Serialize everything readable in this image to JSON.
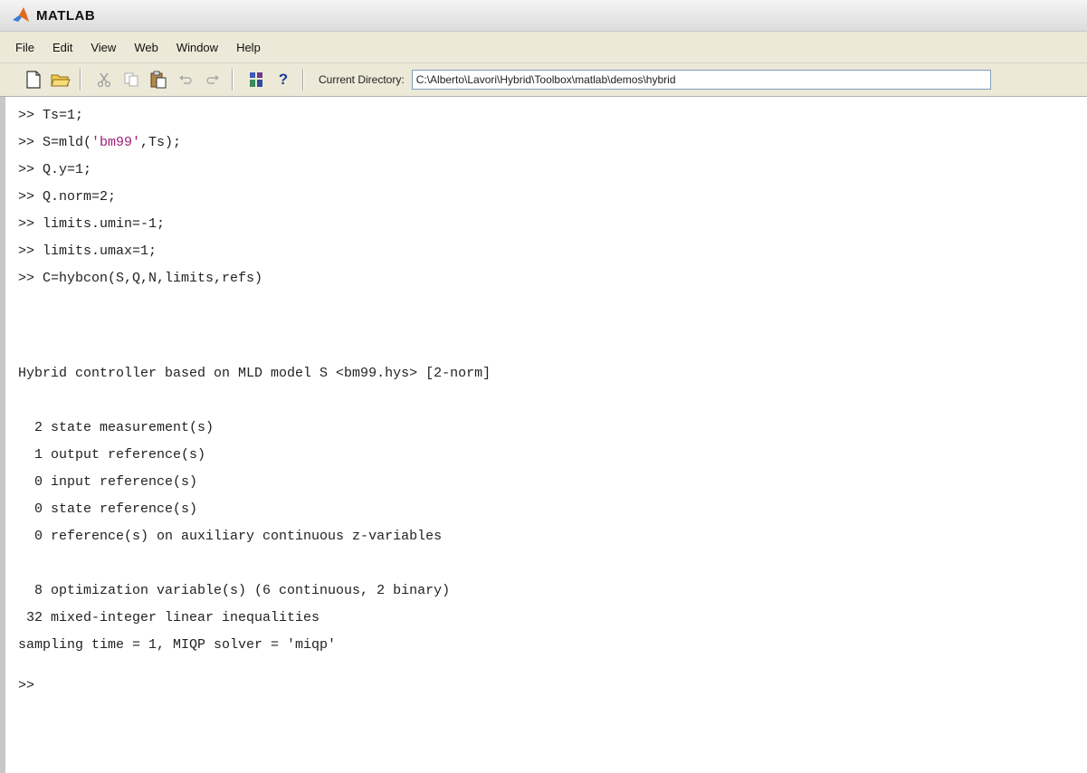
{
  "window": {
    "title": "MATLAB"
  },
  "menu": [
    "File",
    "Edit",
    "View",
    "Web",
    "Window",
    "Help"
  ],
  "toolbar": {
    "buttons": [
      "new-file-icon",
      "open-folder-icon",
      "cut-icon",
      "copy-icon",
      "paste-icon",
      "undo-icon",
      "redo-icon",
      "simulink-icon",
      "help-icon"
    ],
    "help_label": "?",
    "current_directory_label": "Current Directory:",
    "current_directory_value": "C:\\Alberto\\Lavori\\Hybrid\\Toolbox\\matlab\\demos\\hybrid"
  },
  "console": {
    "lines": [
      {
        "text": ">> Ts=1;"
      },
      {
        "pre": ">> S=mld(",
        "str": "'bm99'",
        "post": ",Ts);"
      },
      {
        "text": ">> Q.y=1;"
      },
      {
        "text": ">> Q.norm=2;"
      },
      {
        "text": ">> limits.umin=-1;"
      },
      {
        "text": ">> limits.umax=1;"
      },
      {
        "text": ">> C=hybcon(S,Q,N,limits,refs)"
      },
      {
        "text": "Hybrid controller based on MLD model S <bm99.hys> [2-norm]"
      },
      {
        "text": "  2 state measurement(s)"
      },
      {
        "text": "  1 output reference(s)"
      },
      {
        "text": "  0 input reference(s)"
      },
      {
        "text": "  0 state reference(s)"
      },
      {
        "text": "  0 reference(s) on auxiliary continuous z-variables"
      },
      {
        "text": "  8 optimization variable(s) (6 continuous, 2 binary)"
      },
      {
        "text": " 32 mixed-integer linear inequalities"
      },
      {
        "text": "sampling time = 1, MIQP solver = 'miqp'"
      },
      {
        "text": ">>"
      }
    ]
  }
}
